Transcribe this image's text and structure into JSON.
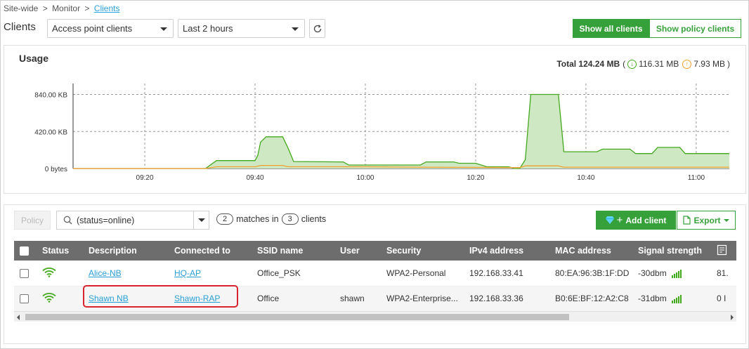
{
  "breadcrumb": {
    "part1": "Site-wide",
    "sep": ">",
    "part2": "Monitor",
    "current": "Clients"
  },
  "page_title": "Clients",
  "filters": {
    "client_type": "Access point clients",
    "time_range": "Last 2 hours"
  },
  "buttons": {
    "show_all": "Show all clients",
    "show_policy": "Show policy clients",
    "policy": "Policy",
    "add_client": "Add client",
    "export": "Export"
  },
  "usage": {
    "title": "Usage",
    "total_label": "Total 124.24 MB",
    "open_paren": "(",
    "download": "116.31 MB",
    "upload": "7.93 MB",
    "close_paren": ")"
  },
  "chart_data": {
    "type": "area",
    "y_ticks": [
      "0 bytes",
      "420.00 KB",
      "840.00 KB"
    ],
    "y_tick_values": [
      0,
      420,
      840
    ],
    "ylim": [
      0,
      900
    ],
    "x_ticks": [
      "09:20",
      "09:40",
      "10:00",
      "10:20",
      "10:40",
      "11:00"
    ],
    "x_tick_values": [
      20,
      40,
      60,
      80,
      100,
      120
    ],
    "xlim": [
      7,
      126
    ],
    "grid": true,
    "series": [
      {
        "color": "#43a91c",
        "fill": "#cfe8c4",
        "points": [
          [
            7,
            0
          ],
          [
            31,
            0
          ],
          [
            33,
            90
          ],
          [
            40,
            90
          ],
          [
            40.5,
            150
          ],
          [
            41,
            300
          ],
          [
            42,
            360
          ],
          [
            45,
            360
          ],
          [
            46,
            230
          ],
          [
            47,
            80
          ],
          [
            56,
            75
          ],
          [
            57,
            40
          ],
          [
            70,
            40
          ],
          [
            71,
            75
          ],
          [
            76,
            75
          ],
          [
            77,
            60
          ],
          [
            80,
            60
          ],
          [
            82,
            20
          ],
          [
            86,
            20
          ],
          [
            87,
            0
          ],
          [
            88,
            0
          ],
          [
            89,
            100
          ],
          [
            90,
            840
          ],
          [
            95,
            840
          ],
          [
            96,
            190
          ],
          [
            102,
            190
          ],
          [
            103,
            220
          ],
          [
            108,
            220
          ],
          [
            109,
            170
          ],
          [
            112,
            170
          ],
          [
            113,
            240
          ],
          [
            117,
            240
          ],
          [
            118,
            170
          ],
          [
            126,
            170
          ]
        ]
      },
      {
        "color": "#f0a030",
        "fill": "none",
        "points": [
          [
            7,
            0
          ],
          [
            31,
            0
          ],
          [
            33,
            20
          ],
          [
            40,
            20
          ],
          [
            41,
            35
          ],
          [
            45,
            35
          ],
          [
            46,
            20
          ],
          [
            60,
            20
          ],
          [
            70,
            15
          ],
          [
            88,
            10
          ],
          [
            89,
            30
          ],
          [
            95,
            30
          ],
          [
            96,
            15
          ],
          [
            126,
            15
          ]
        ]
      }
    ]
  },
  "search": {
    "value": "(status=online)"
  },
  "matches": {
    "count": "2",
    "matches_in": "matches in",
    "clients_count": "3",
    "clients": "clients"
  },
  "table": {
    "headers": [
      "Status",
      "Description",
      "Connected to",
      "SSID name",
      "User",
      "Security",
      "IPv4 address",
      "MAC address",
      "Signal strength"
    ],
    "rows": [
      {
        "description": "Alice-NB",
        "connected_to": "HQ-AP",
        "ssid": "Office_PSK",
        "user": "",
        "security": "WPA2-Personal",
        "ipv4": "192.168.33.41",
        "mac": "80:EA:96:3B:1F:DD",
        "signal": "-30dbm",
        "extra": "81."
      },
      {
        "description": "Shawn NB",
        "connected_to": "Shawn-RAP",
        "ssid": "Office",
        "user": "shawn",
        "security": "WPA2-Enterprise...",
        "ipv4": "192.168.33.36",
        "mac": "B0:6E:BF:12:A2:C8",
        "signal": "-31dbm",
        "extra": "0 I"
      }
    ]
  },
  "colors": {
    "accent": "#36a13a",
    "header_bg": "#6d6d6d",
    "link": "#2a9fd6",
    "highlight": "#d9232e",
    "upload": "#f0a030"
  }
}
